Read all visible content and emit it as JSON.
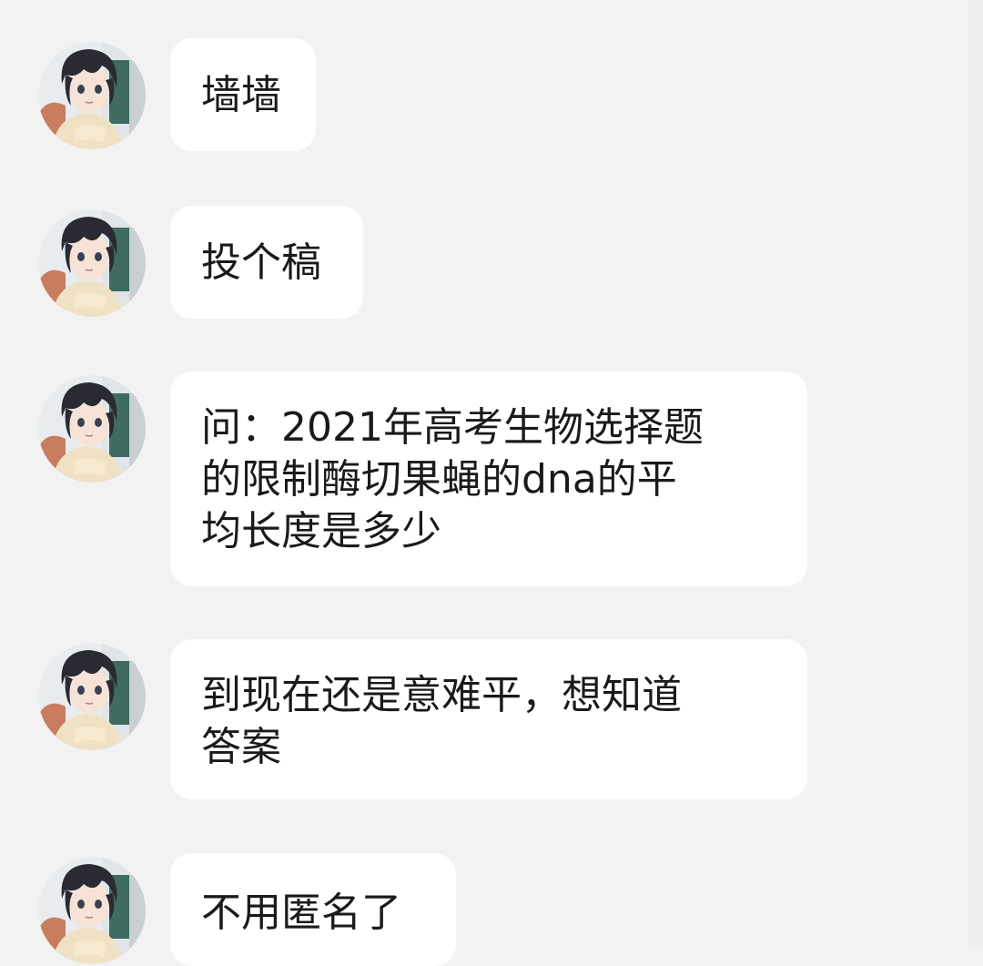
{
  "messages": [
    {
      "text": "墙墙"
    },
    {
      "text": "投个稿"
    },
    {
      "text": "问：2021年高考生物选择题\n的限制酶切果蝇的dna的平\n均长度是多少"
    },
    {
      "text": "到现在还是意难平，想知道\n答案"
    },
    {
      "text": "不用匿名了"
    }
  ],
  "avatar": {
    "icon": "anime-boy-avatar"
  },
  "colors": {
    "background": "#f2f2f2",
    "bubble": "#ffffff",
    "text": "#1a1a1a"
  }
}
